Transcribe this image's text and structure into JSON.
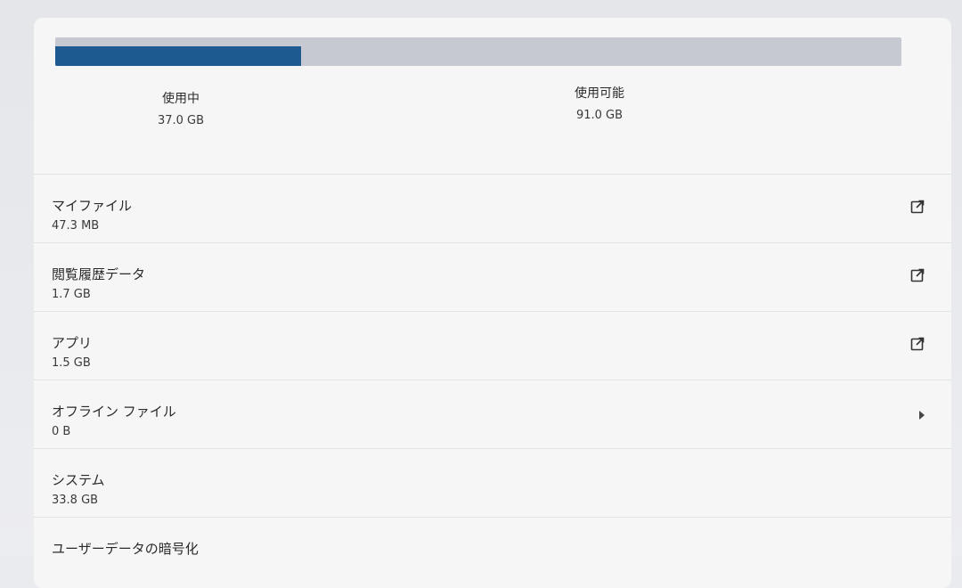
{
  "storage": {
    "used_label": "使用中",
    "used_value": "37.0 GB",
    "available_label": "使用可能",
    "available_value": "91.0 GB",
    "used_fraction": 0.29,
    "bar_color": "#1c5a90",
    "track_color": "#c6c9d1"
  },
  "items": [
    {
      "name": "マイファイル",
      "size": "47.3 MB",
      "action_icon": "open-external-icon"
    },
    {
      "name": "閲覧履歴データ",
      "size": "1.7 GB",
      "action_icon": "open-external-icon"
    },
    {
      "name": "アプリ",
      "size": "1.5 GB",
      "action_icon": "open-external-icon"
    },
    {
      "name": "オフライン ファイル",
      "size": "0 B",
      "action_icon": "chevron-right-icon"
    },
    {
      "name": "システム",
      "size": "33.8 GB",
      "action_icon": ""
    },
    {
      "name": "ユーザーデータの暗号化",
      "size": "",
      "action_icon": ""
    }
  ]
}
